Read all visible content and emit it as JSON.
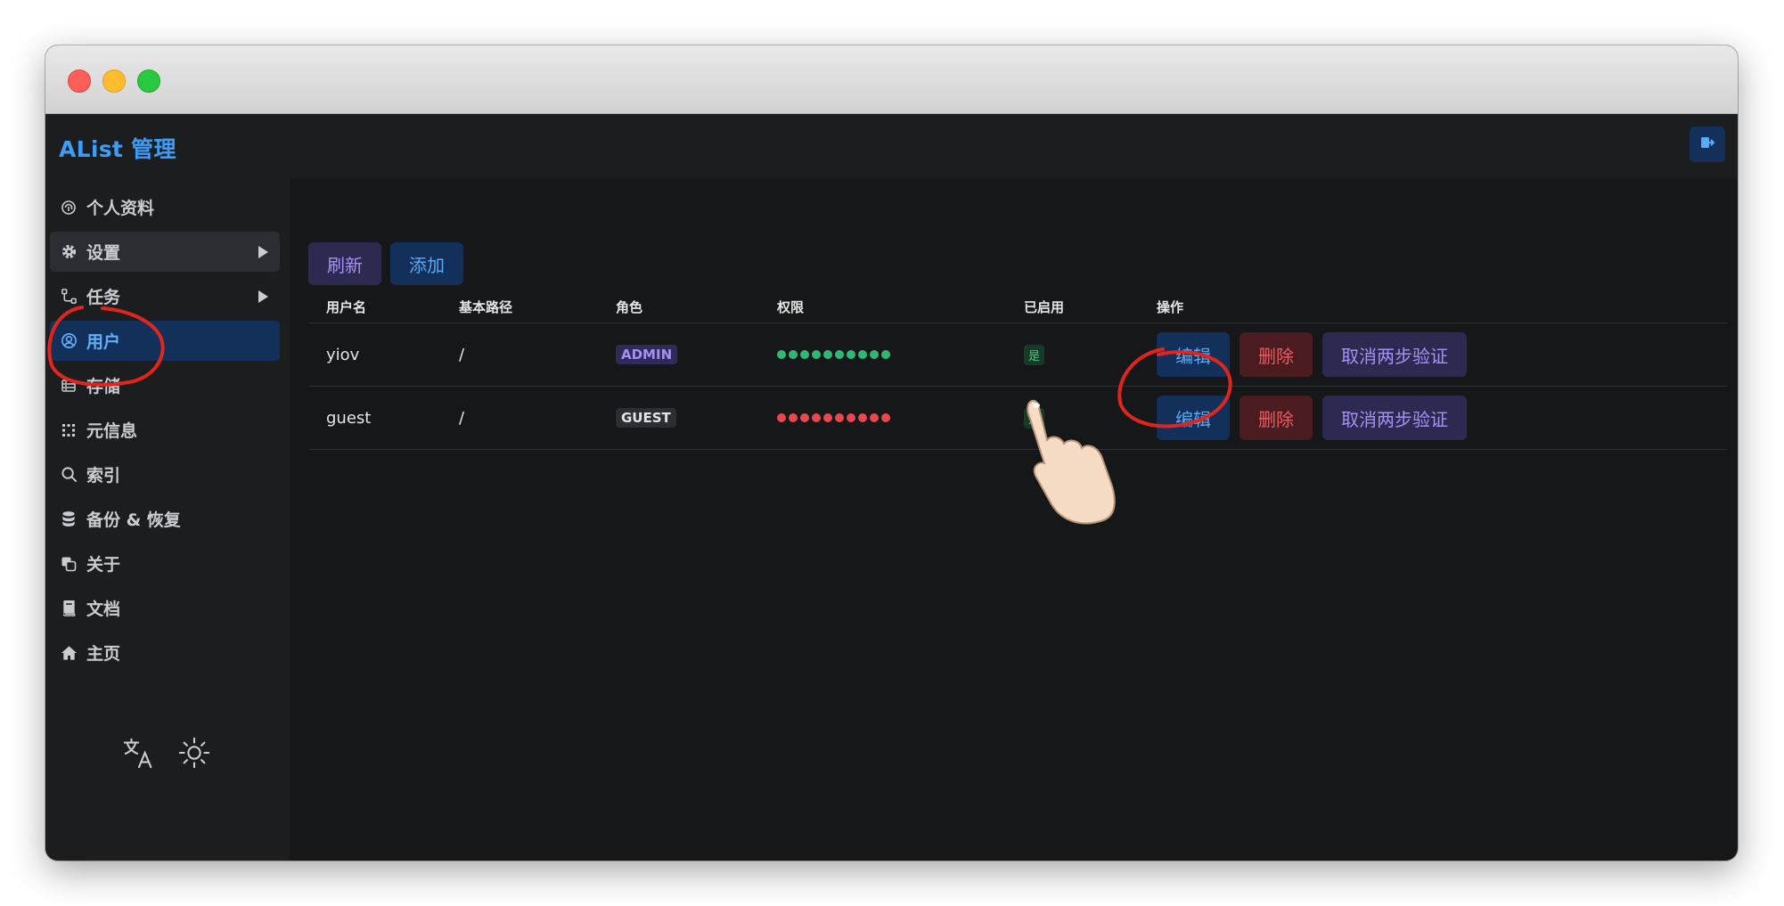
{
  "app": {
    "brand": "AList 管理"
  },
  "sidebar": {
    "items": [
      {
        "label": "个人资料",
        "icon": "fingerprint-icon"
      },
      {
        "label": "设置",
        "icon": "gear-icon",
        "expandable": true
      },
      {
        "label": "任务",
        "icon": "flow-icon",
        "expandable": true
      },
      {
        "label": "用户",
        "icon": "user-circle-icon",
        "active": true
      },
      {
        "label": "存储",
        "icon": "storage-icon"
      },
      {
        "label": "元信息",
        "icon": "meta-grid-icon"
      },
      {
        "label": "索引",
        "icon": "search-icon"
      },
      {
        "label": "备份 & 恢复",
        "icon": "database-icon"
      },
      {
        "label": "关于",
        "icon": "copy-icon"
      },
      {
        "label": "文档",
        "icon": "book-icon"
      },
      {
        "label": "主页",
        "icon": "home-icon"
      }
    ],
    "tools": [
      "translate-icon",
      "sun-icon"
    ]
  },
  "toolbar": {
    "refresh_label": "刷新",
    "add_label": "添加"
  },
  "table": {
    "headers": [
      "用户名",
      "基本路径",
      "角色",
      "权限",
      "已启用",
      "操作"
    ],
    "rows": [
      {
        "username": "yiov",
        "base_path": "/",
        "role": "ADMIN",
        "permissions_color": "#2fb873",
        "permission_dots": 10,
        "enabled": "是"
      },
      {
        "username": "guest",
        "base_path": "/",
        "role": "GUEST",
        "permissions_color": "#e9484f",
        "permission_dots": 10,
        "enabled": "是"
      }
    ],
    "actions": {
      "edit": "编辑",
      "delete": "删除",
      "cancel_2fa": "取消两步验证"
    }
  },
  "colors": {
    "accent": "#3d9cf5",
    "annotation_red": "#e0261c"
  }
}
